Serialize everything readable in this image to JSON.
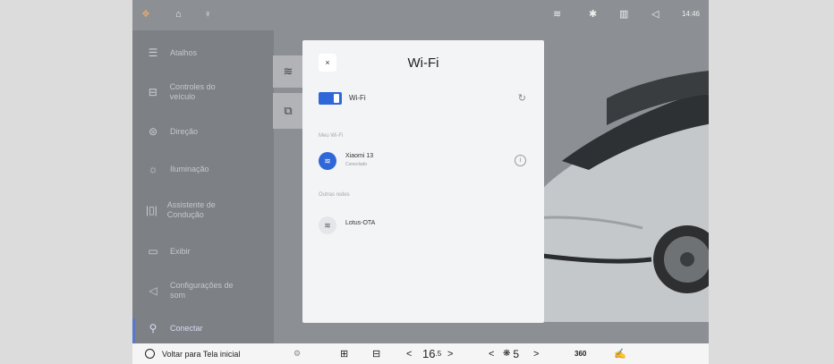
{
  "status_bar": {
    "icons": [
      "app-icon",
      "bell-icon",
      "mic-icon",
      "wifi-icon",
      "bluetooth-icon",
      "signal-icon",
      "volume-icon"
    ],
    "time": "14:46"
  },
  "sidebar": {
    "items": [
      {
        "label": "Atalhos",
        "icon": "shortcuts-icon"
      },
      {
        "label": "Controles do veículo",
        "icon": "car-icon"
      },
      {
        "label": "Direção",
        "icon": "steering-icon"
      },
      {
        "label": "Iluminação",
        "icon": "light-icon"
      },
      {
        "label": "Assistente de Condução",
        "icon": "assist-icon"
      },
      {
        "label": "Exibir",
        "icon": "display-icon"
      },
      {
        "label": "Configurações de som",
        "icon": "sound-icon"
      },
      {
        "label": "Conectar",
        "icon": "link-icon"
      }
    ],
    "active": "Conectar"
  },
  "quick_buttons": [
    "wifi-icon",
    "screen-cast-icon"
  ],
  "wifi_dialog": {
    "close_label": "×",
    "title": "Wi-Fi",
    "toggle_label": "Wi-Fi",
    "toggle_on": true,
    "my_wifi_label": "Meu Wi-Fi",
    "connected_network": {
      "name": "Xiaomi 13",
      "status": "Conectado"
    },
    "other_networks_label": "Outras redes",
    "other_networks": [
      {
        "name": "Lotus-OTA"
      }
    ]
  },
  "bottom_bar": {
    "home_label": "Voltar para Tela inicial",
    "temp_left": "16",
    "temp_left_decimal": ".5",
    "fan_level": "5",
    "view_label": "360",
    "nav_left": "<",
    "nav_right": ">"
  },
  "colors": {
    "accent": "#2f67d8",
    "screen_bg": "#8c8f93",
    "modal_bg": "#f3f4f6"
  }
}
